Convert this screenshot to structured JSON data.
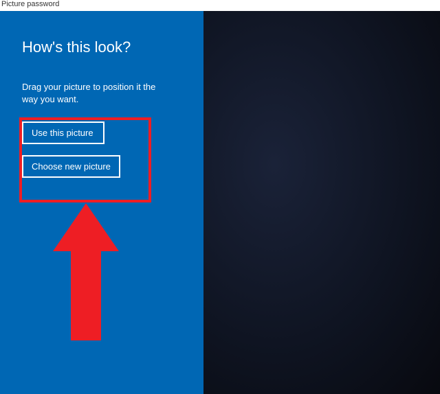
{
  "titlebar": {
    "title": "Picture password"
  },
  "panel": {
    "heading": "How's this look?",
    "instruction": "Drag your picture to position it the way you want.",
    "buttons": {
      "use": "Use this picture",
      "choose": "Choose new picture"
    }
  },
  "annotation": {
    "highlight_color": "#ee1e24",
    "arrow_color": "#ee1e24"
  }
}
